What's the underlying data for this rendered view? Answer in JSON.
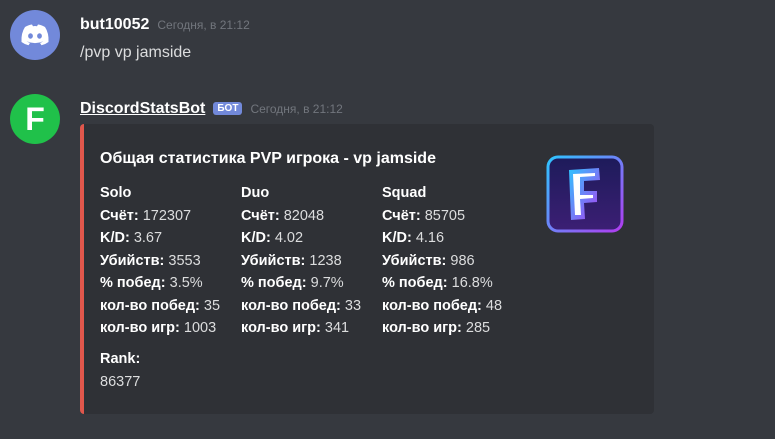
{
  "message1": {
    "username": "but10052",
    "timestamp": "Сегодня, в 21:12",
    "text": "/pvp vp jamside"
  },
  "message2": {
    "username": "DiscordStatsBot",
    "bot_tag": "БОТ",
    "timestamp": "Сегодня, в 21:12",
    "avatar_letter": "F",
    "embed": {
      "accent_color": "#e0574c",
      "title": "Общая статистика PVP игрока - vp jamside",
      "thumbnail_letter": "F",
      "fields": [
        {
          "name": "Solo",
          "rows": [
            {
              "k": "Счёт:",
              "v": "172307"
            },
            {
              "k": "K/D:",
              "v": "3.67"
            },
            {
              "k": "Убийств:",
              "v": "3553"
            },
            {
              "k": "% побед:",
              "v": "3.5%"
            },
            {
              "k": "кол-во побед:",
              "v": "35"
            },
            {
              "k": "кол-во игр:",
              "v": "1003"
            }
          ]
        },
        {
          "name": "Duo",
          "rows": [
            {
              "k": "Счёт:",
              "v": "82048"
            },
            {
              "k": "K/D:",
              "v": "4.02"
            },
            {
              "k": "Убийств:",
              "v": "1238"
            },
            {
              "k": "% побед:",
              "v": "9.7%"
            },
            {
              "k": "кол-во побед:",
              "v": "33"
            },
            {
              "k": "кол-во игр:",
              "v": "341"
            }
          ]
        },
        {
          "name": "Squad",
          "rows": [
            {
              "k": "Счёт:",
              "v": "85705"
            },
            {
              "k": "K/D:",
              "v": "4.16"
            },
            {
              "k": "Убийств:",
              "v": "986"
            },
            {
              "k": "% побед:",
              "v": "16.8%"
            },
            {
              "k": "кол-во побед:",
              "v": "48"
            },
            {
              "k": "кол-во игр:",
              "v": "285"
            }
          ]
        }
      ],
      "rank": {
        "name": "Rank:",
        "value": "86377"
      }
    }
  }
}
